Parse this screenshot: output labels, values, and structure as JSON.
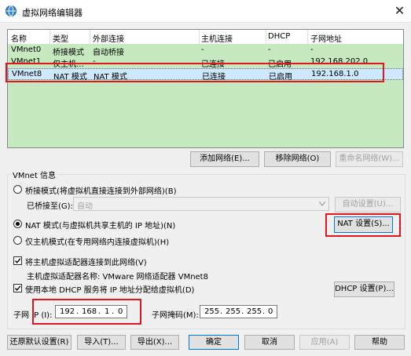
{
  "window": {
    "title": "虚拟网络编辑器",
    "close_glyph": "✕"
  },
  "table": {
    "headers": [
      "名称",
      "类型",
      "外部连接",
      "主机连接",
      "DHCP",
      "子网地址"
    ],
    "rows": [
      [
        "VMnet0",
        "桥接模式",
        "自动桥接",
        "-",
        "-",
        "-"
      ],
      [
        "VMnet1",
        "仅主机...",
        "-",
        "已连接",
        "已启用",
        "192.168.202.0"
      ],
      [
        "VMnet8",
        "NAT 模式",
        "NAT 模式",
        "已连接",
        "已启用",
        "192.168.1.0"
      ]
    ],
    "selected_row": 2
  },
  "net_buttons": {
    "add": "添加网络(E)...",
    "remove": "移除网络(O)",
    "rename": "重命名网络(W)..."
  },
  "info": {
    "group_title": "VMnet 信息",
    "bridge_mode": "桥接模式(将虚拟机直接连接到外部网络)(B)",
    "bridged_to_label": "已桥接至(G):",
    "bridged_to_value": "自动",
    "auto_settings": "自动设置(U)...",
    "nat_mode": "NAT 模式(与虚拟机共享主机的 IP 地址)(N)",
    "nat_settings": "NAT 设置(S)...",
    "host_only": "仅主机模式(在专用网络内连接虚拟机)(H)",
    "connect_adapter": "将主机虚拟适配器连接到此网络(V)",
    "adapter_name": "主机虚拟适配器名称: VMware 网络适配器 VMnet8",
    "use_dhcp": "使用本地 DHCP 服务将 IP 地址分配给虚拟机(D)",
    "dhcp_settings": "DHCP 设置(P)...",
    "selected_mode": "nat",
    "connect_adapter_checked": true,
    "use_dhcp_checked": true
  },
  "subnet": {
    "ip_label": "子网 IP (I):",
    "ip": [
      "192",
      "168",
      "1",
      "0"
    ],
    "mask_label": "子网掩码(M):",
    "mask": [
      "255",
      "255",
      "255",
      "0"
    ]
  },
  "bottom_buttons": {
    "restore": "还原默认设置(R)",
    "import": "导入(T)...",
    "export": "导出(X)...",
    "ok": "确定",
    "cancel": "取消",
    "apply": "应用(A)",
    "help": "帮助"
  },
  "colors": {
    "highlight_red": "#e3151e",
    "row_green": "#c7e9c0",
    "selected_row": "#cde8ff"
  }
}
